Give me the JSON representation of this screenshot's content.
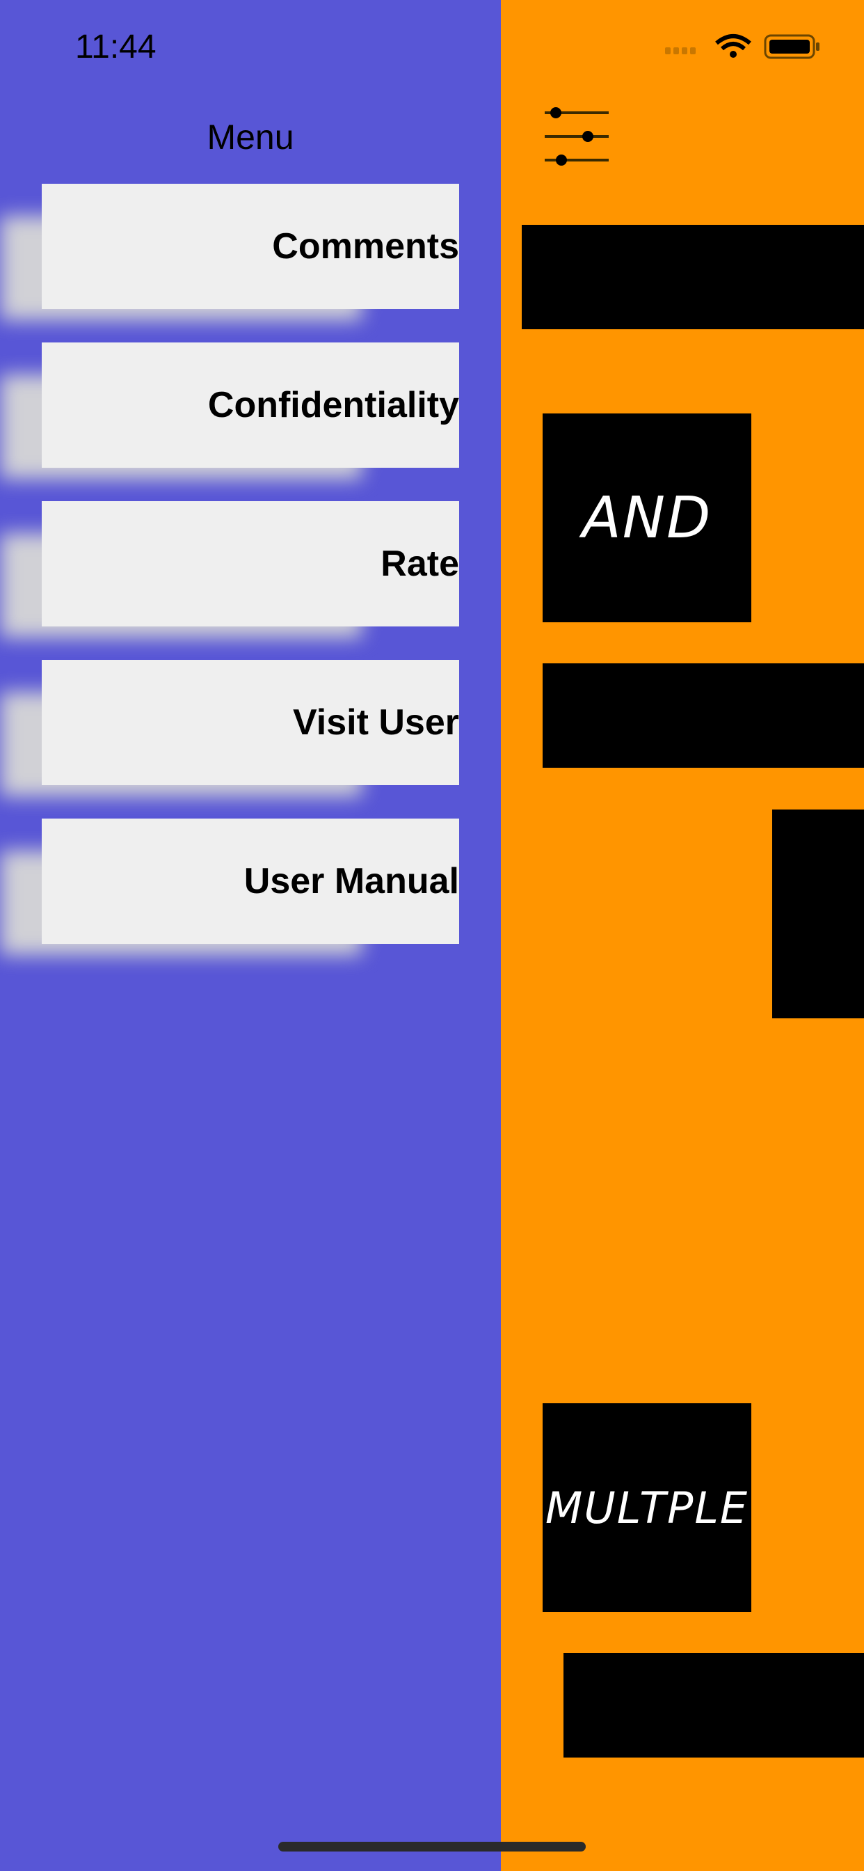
{
  "status_bar": {
    "time": "11:44"
  },
  "drawer": {
    "title": "Menu",
    "items": [
      {
        "label": "Comments"
      },
      {
        "label": "Confidentiality"
      },
      {
        "label": "Rate"
      },
      {
        "label": "Visit User"
      },
      {
        "label": "User Manual"
      }
    ]
  },
  "content": {
    "tiles": [
      {
        "text": "AND"
      },
      {
        "text": "MULTPLE"
      }
    ]
  },
  "colors": {
    "drawer_bg": "#5856d6",
    "content_bg": "#ff9500",
    "menu_item_bg": "#efefef"
  }
}
